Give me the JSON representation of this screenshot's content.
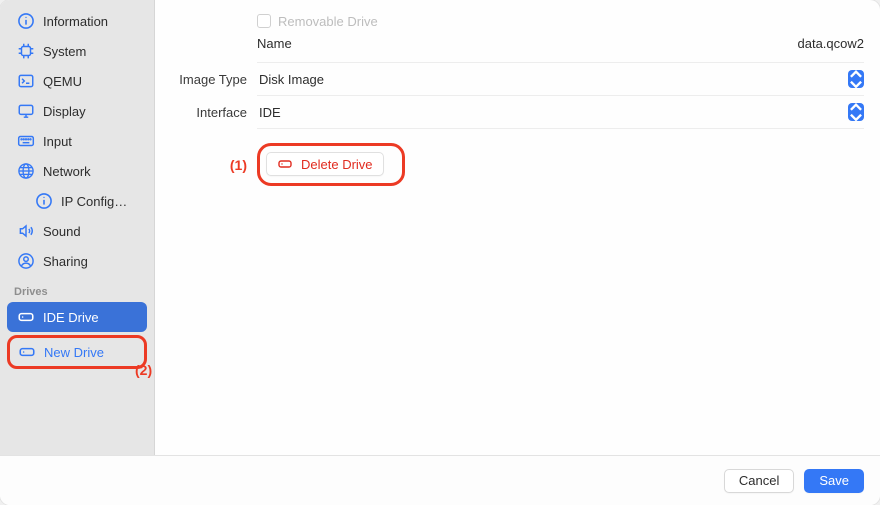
{
  "sidebar": {
    "items": [
      {
        "label": "Information",
        "icon": "info-icon"
      },
      {
        "label": "System",
        "icon": "chip-icon"
      },
      {
        "label": "QEMU",
        "icon": "terminal-icon"
      },
      {
        "label": "Display",
        "icon": "display-icon"
      },
      {
        "label": "Input",
        "icon": "keyboard-icon"
      },
      {
        "label": "Network",
        "icon": "globe-icon"
      },
      {
        "label": "IP Config…",
        "icon": "info-icon"
      },
      {
        "label": "Sound",
        "icon": "speaker-icon"
      },
      {
        "label": "Sharing",
        "icon": "person-circle-icon"
      }
    ],
    "drives_header": "Drives",
    "drives": [
      {
        "label": "IDE Drive",
        "icon": "drive-icon",
        "selected": true
      }
    ],
    "new_drive_label": "New Drive"
  },
  "form": {
    "removable_label": "Removable Drive",
    "name_label": "Name",
    "name_value": "data.qcow2",
    "image_type_label": "Image Type",
    "image_type_value": "Disk Image",
    "interface_label": "Interface",
    "interface_value": "IDE",
    "delete_label": "Delete Drive"
  },
  "annotations": {
    "one": "(1)",
    "two": "(2)"
  },
  "footer": {
    "cancel": "Cancel",
    "save": "Save"
  }
}
